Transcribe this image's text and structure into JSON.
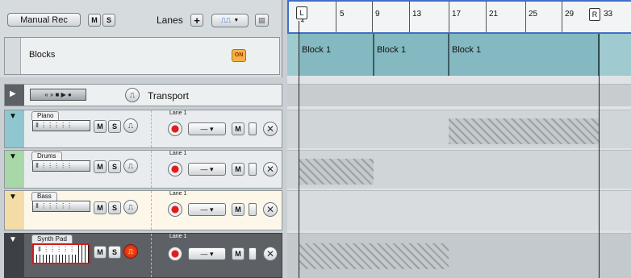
{
  "header": {
    "manual_rec": "Manual Rec",
    "m": "M",
    "s": "S",
    "lanes_label": "Lanes",
    "plus": "+"
  },
  "blocks_track": {
    "label": "Blocks",
    "on": "ON"
  },
  "transport": {
    "label": "Transport",
    "buttons": "« » ■ ▶ ●"
  },
  "tracks": [
    {
      "name": "Piano",
      "lane": "Lane 1",
      "color": "#8fc6cf",
      "selected": false
    },
    {
      "name": "Drums",
      "lane": "Lane 1",
      "color": "#a8d8a8",
      "selected": false
    },
    {
      "name": "Bass",
      "lane": "Lane 1",
      "color": "#f3dca5",
      "selected": false
    },
    {
      "name": "Synth Pad",
      "lane": "Lane 1",
      "color": "#5d6166",
      "selected": true
    }
  ],
  "kbd_text": "Ⅱ ⋮⋮⋮⋮⋮",
  "ruler": {
    "numbers": [
      "5",
      "9",
      "13",
      "17",
      "21",
      "25",
      "29",
      "33"
    ],
    "left_marker": "L",
    "right_marker": "R",
    "loop_sub": "4"
  },
  "blocks": [
    {
      "label": "Block 1"
    },
    {
      "label": "Block 1"
    },
    {
      "label": "Block 1"
    }
  ],
  "colors": {
    "accent": "#3f6fc8",
    "selected_outline": "#d21d1d"
  }
}
